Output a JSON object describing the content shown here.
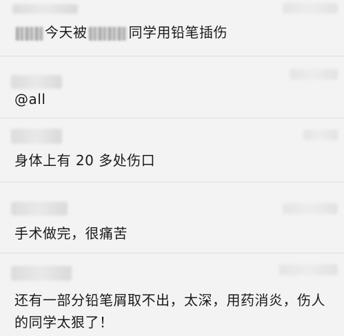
{
  "messages": [
    {
      "id": "m1",
      "segments": [
        "今天被",
        "同学用铅笔插伤"
      ]
    },
    {
      "id": "m2",
      "text": "@all"
    },
    {
      "id": "m3",
      "text": "身体上有 20 多处伤口"
    },
    {
      "id": "m4",
      "text": "手术做完，很痛苦"
    },
    {
      "id": "m5",
      "text": "还有一部分铅笔屑取不出，太深，用药消炎，伤人的同学太狠了！"
    }
  ]
}
